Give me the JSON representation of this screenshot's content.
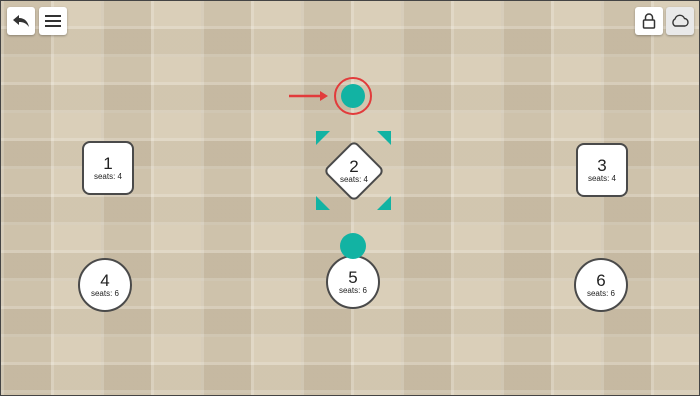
{
  "toolbar": {
    "back_icon": "back-arrow-icon",
    "menu_icon": "hamburger-menu-icon",
    "lock_icon": "lock-icon",
    "cloud_icon": "cloud-icon"
  },
  "colors": {
    "accent": "#12b3a3",
    "highlight": "#e23b3b",
    "table_border": "#4a4a4a"
  },
  "tables": [
    {
      "number": "1",
      "seats": "seats: 4"
    },
    {
      "number": "2",
      "seats": "seats: 4"
    },
    {
      "number": "3",
      "seats": "seats: 4"
    },
    {
      "number": "4",
      "seats": "seats: 6"
    },
    {
      "number": "5",
      "seats": "seats: 6"
    },
    {
      "number": "6",
      "seats": "seats: 6"
    }
  ]
}
